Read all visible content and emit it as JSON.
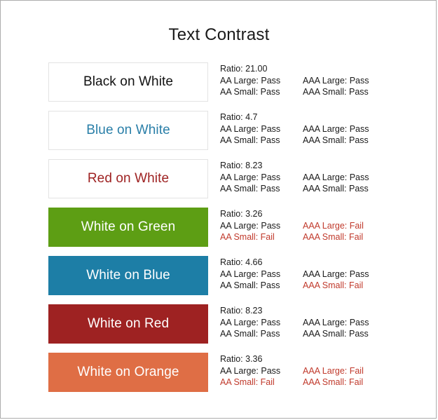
{
  "page": {
    "title": "Text Contrast",
    "background": "#ffffff",
    "border_color": "#adadad",
    "fail_color": "#c0392b",
    "pass_color": "#1a1a1a"
  },
  "columns": {
    "ratio_prefix": "Ratio:",
    "aa_large_label": "AA Large:",
    "aa_small_label": "AA Small:",
    "aaa_large_label": "AAA Large:",
    "aaa_small_label": "AAA Small:"
  },
  "rows": [
    {
      "label": "Black on White",
      "background": "#ffffff",
      "text_color": "#111111",
      "border_color": "#e3e3e3",
      "ratio": "Ratio: 21.00",
      "aa_large": "AA Large: Pass",
      "aa_large_verdict": "Pass",
      "aa_small": "AA Small: Pass",
      "aa_small_verdict": "Pass",
      "aaa_large": "AAA Large: Pass",
      "aaa_large_verdict": "Pass",
      "aaa_small": "AAA Small: Pass",
      "aaa_small_verdict": "Pass"
    },
    {
      "label": "Blue on White",
      "background": "#ffffff",
      "text_color": "#2a7fa8",
      "border_color": "#e3e3e3",
      "ratio": "Ratio: 4.7",
      "aa_large": "AA Large: Pass",
      "aa_large_verdict": "Pass",
      "aa_small": "AA Small: Pass",
      "aa_small_verdict": "Pass",
      "aaa_large": "AAA Large: Pass",
      "aaa_large_verdict": "Pass",
      "aaa_small": "AAA Small: Pass",
      "aaa_small_verdict": "Pass"
    },
    {
      "label": "Red on White",
      "background": "#ffffff",
      "text_color": "#9e2222",
      "border_color": "#e3e3e3",
      "ratio": "Ratio: 8.23",
      "aa_large": "AA Large: Pass",
      "aa_large_verdict": "Pass",
      "aa_small": "AA Small: Pass",
      "aa_small_verdict": "Pass",
      "aaa_large": "AAA Large: Pass",
      "aaa_large_verdict": "Pass",
      "aaa_small": "AAA Small: Pass",
      "aaa_small_verdict": "Pass"
    },
    {
      "label": "White on Green",
      "background": "#5d9e14",
      "text_color": "#ffffff",
      "border_color": "#5d9e14",
      "ratio": "Ratio: 3.26",
      "aa_large": "AA Large: Pass",
      "aa_large_verdict": "Pass",
      "aa_small": "AA Small: Fail",
      "aa_small_verdict": "Fail",
      "aaa_large": "AAA Large: Fail",
      "aaa_large_verdict": "Fail",
      "aaa_small": "AAA Small: Fail",
      "aaa_small_verdict": "Fail"
    },
    {
      "label": "White on Blue",
      "background": "#1d7ea6",
      "text_color": "#ffffff",
      "border_color": "#1d7ea6",
      "ratio": "Ratio: 4.66",
      "aa_large": "AA Large: Pass",
      "aa_large_verdict": "Pass",
      "aa_small": "AA Small: Pass",
      "aa_small_verdict": "Pass",
      "aaa_large": "AAA Large: Pass",
      "aaa_large_verdict": "Pass",
      "aaa_small": "AAA Small: Fail",
      "aaa_small_verdict": "Fail"
    },
    {
      "label": "White on Red",
      "background": "#9e2222",
      "text_color": "#ffffff",
      "border_color": "#9e2222",
      "ratio": "Ratio: 8.23",
      "aa_large": "AA Large: Pass",
      "aa_large_verdict": "Pass",
      "aa_small": "AA Small: Pass",
      "aa_small_verdict": "Pass",
      "aaa_large": "AAA Large: Pass",
      "aaa_large_verdict": "Pass",
      "aaa_small": "AAA Small: Pass",
      "aaa_small_verdict": "Pass"
    },
    {
      "label": "White on Orange",
      "background": "#df6e45",
      "text_color": "#ffffff",
      "border_color": "#df6e45",
      "ratio": "Ratio: 3.36",
      "aa_large": "AA Large: Pass",
      "aa_large_verdict": "Pass",
      "aa_small": "AA Small: Fail",
      "aa_small_verdict": "Fail",
      "aaa_large": "AAA Large: Fail",
      "aaa_large_verdict": "Fail",
      "aaa_small": "AAA Small: Fail",
      "aaa_small_verdict": "Fail"
    }
  ]
}
